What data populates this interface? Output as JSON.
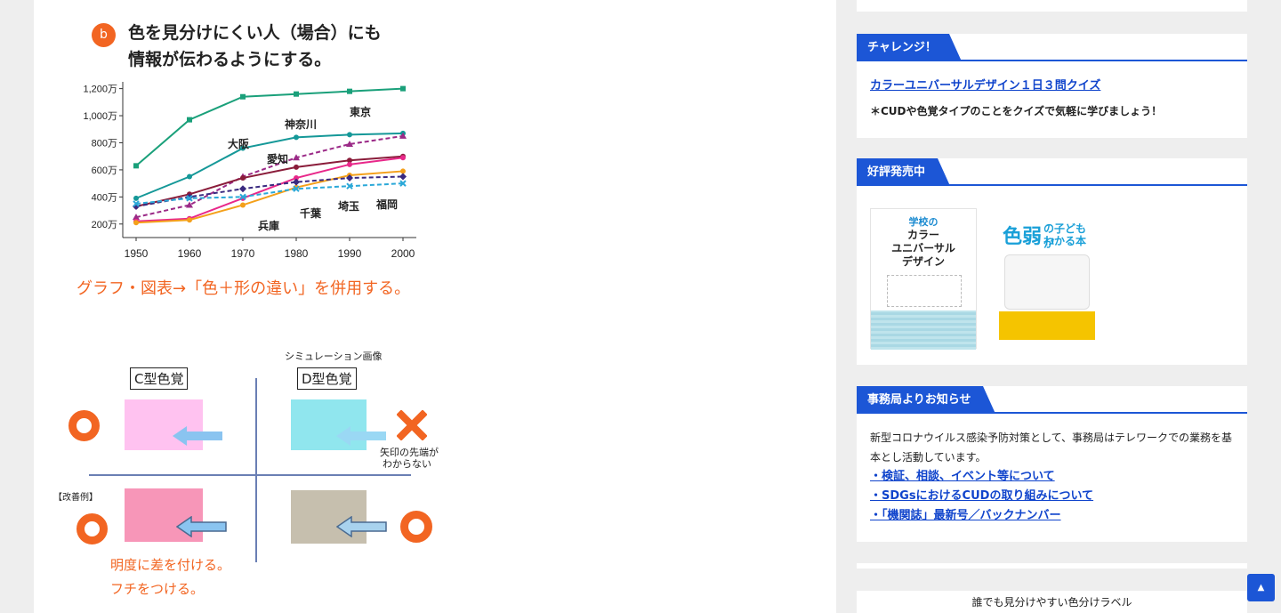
{
  "main": {
    "badge": "b",
    "heading_line1": "色を見分けにくい人（場合）にも",
    "heading_line2": "情報が伝わるようにする。",
    "chart_caption": "グラフ・図表→「色＋形の違い」を併用する。",
    "sim_label": "シミュレーション画像",
    "c_type": "C型色覚",
    "d_type": "D型色覚",
    "arrow_note_1": "矢印の先端が",
    "arrow_note_2": "わからない",
    "improve_label": "【改善例】",
    "improve_note_1": "明度に差を付ける。",
    "improve_note_2": "フチをつける。",
    "colors": {
      "accent": "#f26522",
      "orange_text": "#f26522"
    }
  },
  "chart_data": {
    "type": "line",
    "x": [
      1950,
      1960,
      1970,
      1980,
      1990,
      2000
    ],
    "ytick_labels": [
      "200万",
      "400万",
      "600万",
      "800万",
      "1,000万",
      "1,200万"
    ],
    "ylim": [
      100,
      1250
    ],
    "series": [
      {
        "name": "東京",
        "values": [
          630,
          970,
          1140,
          1160,
          1180,
          1200
        ],
        "color": "#1aa07a",
        "dash": false,
        "marker": "square"
      },
      {
        "name": "大阪",
        "values": [
          390,
          550,
          760,
          840,
          860,
          870
        ],
        "color": "#159898",
        "dash": false,
        "marker": "circle"
      },
      {
        "name": "神奈川",
        "values": [
          250,
          340,
          550,
          690,
          790,
          850
        ],
        "color": "#9b2a87",
        "dash": true,
        "marker": "triangle"
      },
      {
        "name": "愛知",
        "values": [
          330,
          420,
          540,
          620,
          670,
          700
        ],
        "color": "#8a1c3a",
        "dash": false,
        "marker": "circle"
      },
      {
        "name": "埼玉",
        "values": [
          220,
          240,
          390,
          540,
          640,
          690
        ],
        "color": "#e8288a",
        "dash": false,
        "marker": "circle"
      },
      {
        "name": "千葉",
        "values": [
          210,
          230,
          340,
          470,
          560,
          590
        ],
        "color": "#f4a01a",
        "dash": false,
        "marker": "circle"
      },
      {
        "name": "兵庫",
        "values": [
          330,
          400,
          460,
          510,
          540,
          550
        ],
        "color": "#3a2a80",
        "dash": true,
        "marker": "diamond"
      },
      {
        "name": "福岡",
        "values": [
          350,
          390,
          400,
          460,
          480,
          500
        ],
        "color": "#2aa8d8",
        "dash": true,
        "marker": "x"
      }
    ]
  },
  "sidebar": {
    "challenge": {
      "title": "チャレンジ！",
      "link": "カラーユニバーサルデザイン１日３問クイズ",
      "note": "＊CUDや色覚タイプのことをクイズで気軽に学びましょう！"
    },
    "books": {
      "title": "好評発売中",
      "book1_title_1": "学校の",
      "book1_title_2": "カラー",
      "book1_title_3": "ユニバーサル",
      "book1_title_4": "デザイン",
      "book2_title_1": "色弱",
      "book2_title_2": "の子どもが",
      "book2_title_3": "わかる本"
    },
    "news": {
      "title": "事務局よりお知らせ",
      "body_1": "新型コロナウイルス感染予防対策として、事務局はテレワークでの業務を基",
      "body_2": "本とし活動しています。",
      "links": [
        "・検証、相談、イベント等について",
        "・SDGsにおけるCUDの取り組みについて",
        "・「機関誌」最新号／バックナンバー"
      ]
    },
    "bottom_label": "誰でも見分けやすい色分けラベル"
  },
  "back_to_top": "▲"
}
